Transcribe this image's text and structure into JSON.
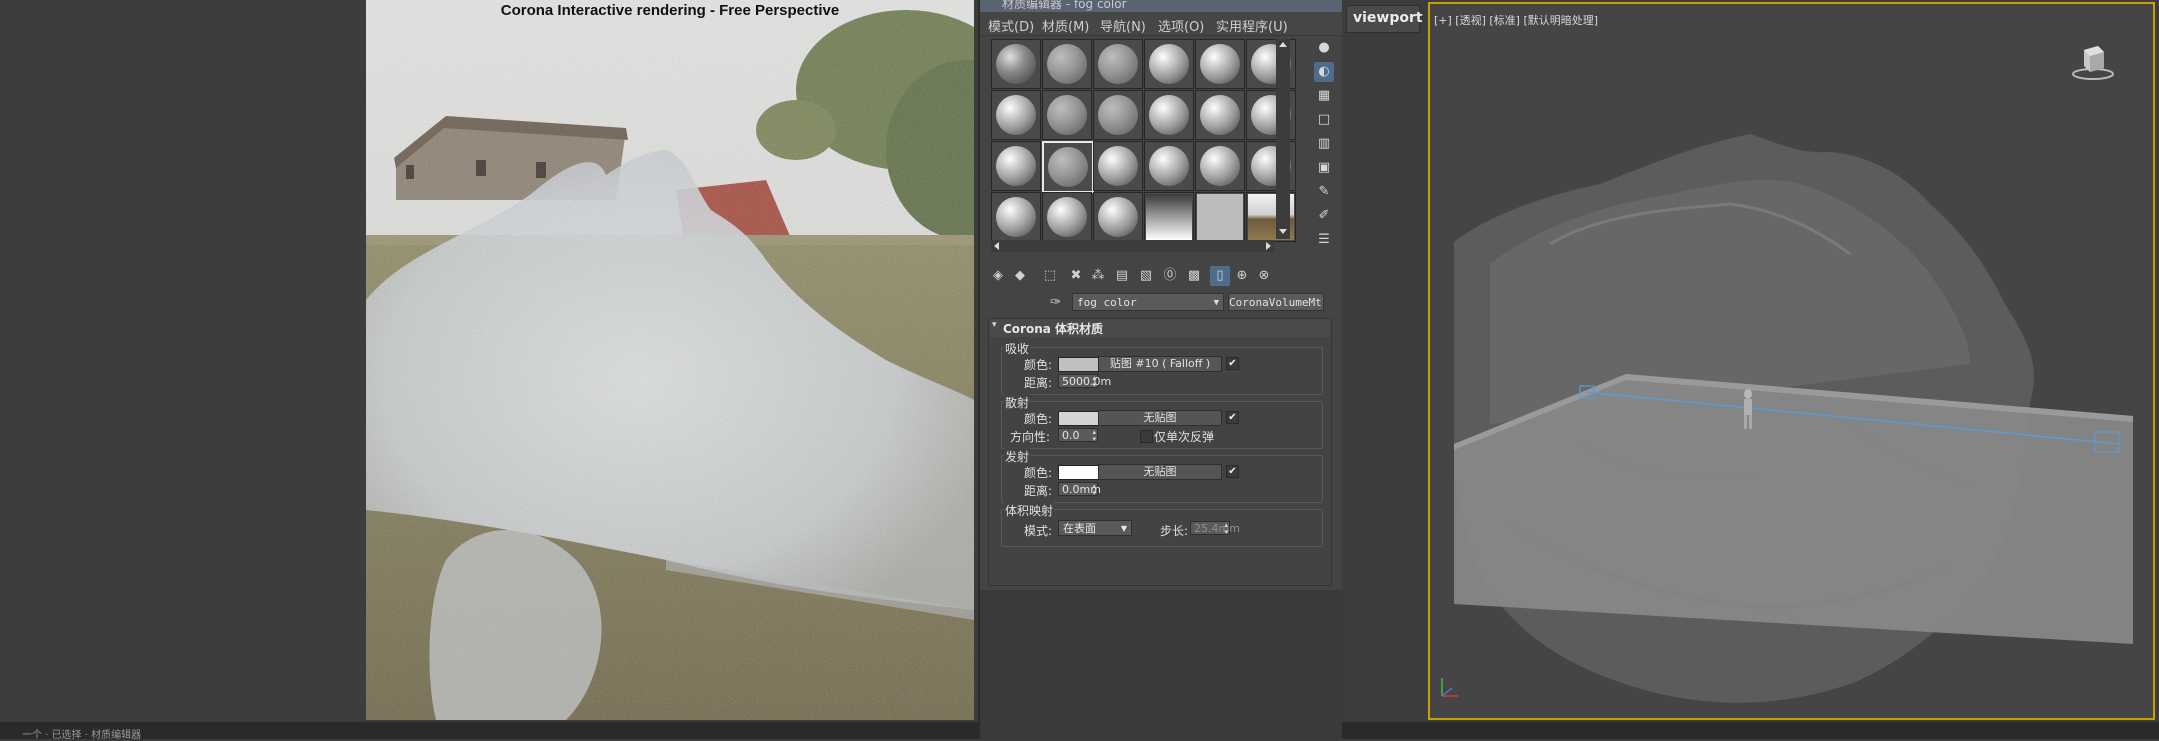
{
  "render_window": {
    "title": "Corona Interactive rendering - Free Perspective"
  },
  "status_bar": {
    "left_text": "一个 · 已选择 · 材质编辑器"
  },
  "material_editor": {
    "title": "材质编辑器 - fog color",
    "menus": [
      "模式(D)",
      "材质(M)",
      "导航(N)",
      "选项(O)",
      "实用程序(U)"
    ],
    "current_material": "fog color",
    "material_type": "CoronaVolumeMtl",
    "rollout_title": "Corona 体积材质",
    "absorption": {
      "group_label": "吸收",
      "color_label": "颜色:",
      "color": "#c0c0c0",
      "map_label": "贴图 #10 ( Falloff )",
      "distance_label": "距离:",
      "distance_value": "5000.0m"
    },
    "scattering": {
      "group_label": "散射",
      "color_label": "颜色:",
      "color": "#d4d4d4",
      "map_label": "无贴图",
      "directionality_label": "方向性:",
      "directionality_value": "0.0",
      "single_bounce_label": "仅单次反弹"
    },
    "emission": {
      "group_label": "发射",
      "color_label": "颜色:",
      "color": "#ffffff",
      "map_label": "无贴图",
      "distance_label": "距离:",
      "distance_value": "0.0mm"
    },
    "volume_mapping": {
      "group_label": "体积映射",
      "mode_label": "模式:",
      "mode_value": "在表面",
      "step_label": "步长:",
      "step_value": "25.4mm"
    }
  },
  "viewport": {
    "tab_label": "viewport",
    "label": "[+] [透视] [标准] [默认明暗处理]"
  }
}
